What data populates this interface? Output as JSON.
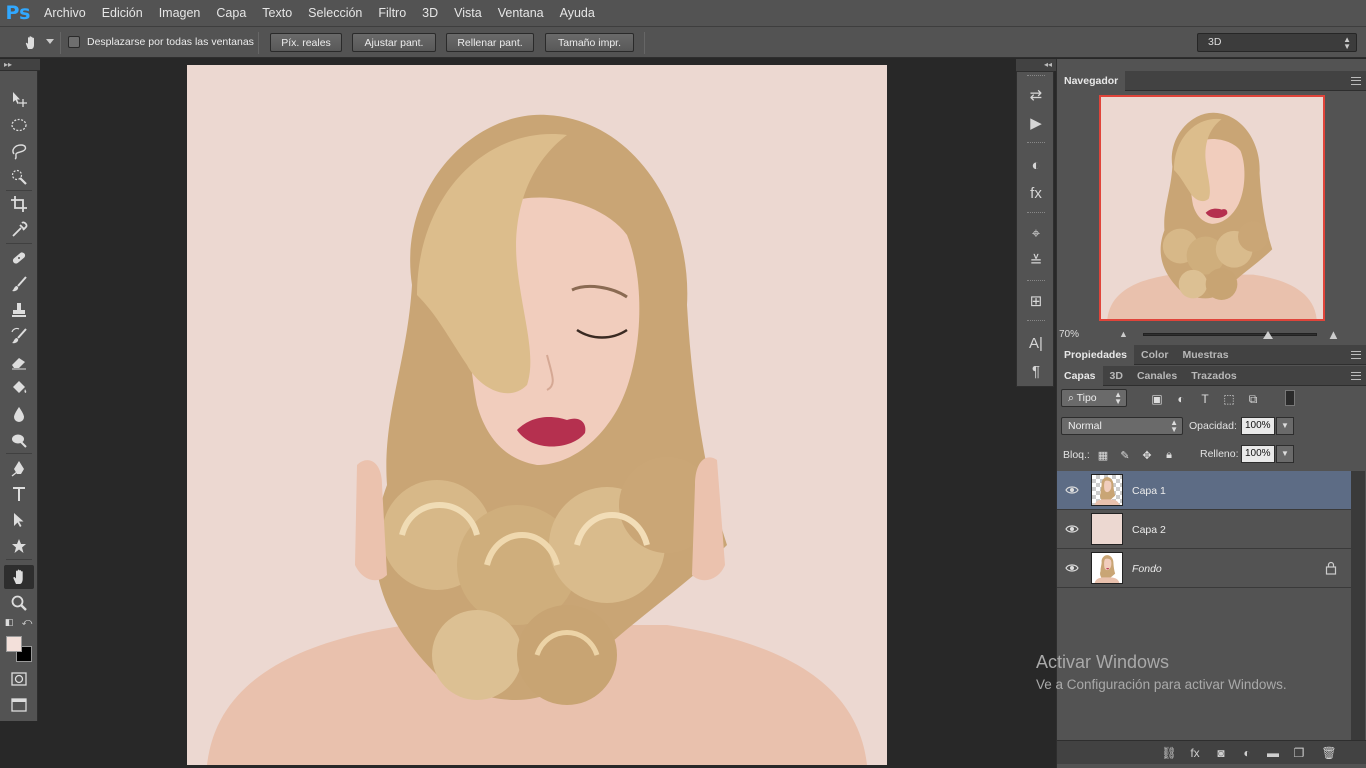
{
  "app": {
    "logo": "Ps"
  },
  "menu": [
    "Archivo",
    "Edición",
    "Imagen",
    "Capa",
    "Texto",
    "Selección",
    "Filtro",
    "3D",
    "Vista",
    "Ventana",
    "Ayuda"
  ],
  "options": {
    "scroll_all_label": "Desplazarse por todas las ventanas",
    "buttons": [
      "Píx. reales",
      "Ajustar pant.",
      "Rellenar pant.",
      "Tamaño impr."
    ],
    "workspace": "3D"
  },
  "toolbar": {
    "tools": [
      "move-tool-icon",
      "elliptical-marquee-icon",
      "lasso-icon",
      "quick-selection-icon",
      "crop-icon",
      "eyedropper-icon",
      "healing-brush-icon",
      "brush-icon",
      "clone-stamp-icon",
      "history-brush-icon",
      "eraser-icon",
      "paint-bucket-icon",
      "blur-icon",
      "dodge-icon",
      "pen-icon",
      "type-icon",
      "path-selection-icon",
      "shape-icon",
      "hand-icon",
      "zoom-icon"
    ],
    "active_tool": "hand-icon",
    "foreground_color": "#f3e0da",
    "background_color": "#000000"
  },
  "navigator": {
    "tab": "Navegador",
    "zoom": "70%",
    "zoom_slider": 0.72,
    "view_box_color": "#e0443a"
  },
  "props_tabs": [
    "Propiedades",
    "Color",
    "Muestras"
  ],
  "layers_tabs": [
    "Capas",
    "3D",
    "Canales",
    "Trazados"
  ],
  "layers": {
    "filter_kind": "Tipo",
    "blend_mode": "Normal",
    "opacity_label": "Opacidad:",
    "opacity": "100%",
    "lock_label": "Bloq.:",
    "fill_label": "Relleno:",
    "fill": "100%",
    "items": [
      {
        "name": "Capa 1",
        "selected": true,
        "thumb": "checker-portrait",
        "locked": false
      },
      {
        "name": "Capa 2",
        "selected": false,
        "thumb": "solid",
        "locked": false
      },
      {
        "name": "Fondo",
        "selected": false,
        "thumb": "portrait",
        "locked": true
      }
    ]
  },
  "watermark": {
    "title": "Activar Windows",
    "subtitle": "Ve a Configuración para activar Windows."
  },
  "canvas": {
    "background_color": "#ecd8d1"
  }
}
